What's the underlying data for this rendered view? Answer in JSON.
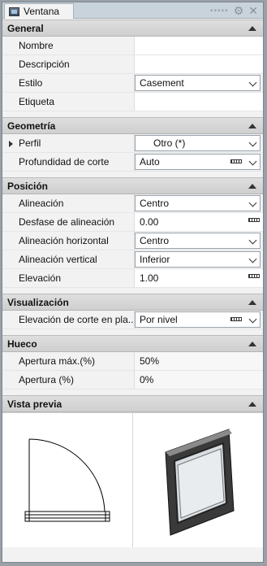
{
  "window": {
    "title": "Ventana"
  },
  "sections": {
    "general": {
      "title": "General",
      "nombre": {
        "label": "Nombre",
        "value": ""
      },
      "descripcion": {
        "label": "Descripción",
        "value": ""
      },
      "estilo": {
        "label": "Estilo",
        "value": "Casement"
      },
      "etiqueta": {
        "label": "Etiqueta",
        "value": ""
      }
    },
    "geometria": {
      "title": "Geometría",
      "perfil": {
        "label": "Perfil",
        "value": "Otro (*)"
      },
      "profundidad": {
        "label": "Profundidad de corte",
        "value": "Auto"
      }
    },
    "posicion": {
      "title": "Posición",
      "alineacion": {
        "label": "Alineación",
        "value": "Centro"
      },
      "desfase": {
        "label": "Desfase de alineación",
        "value": "0.00"
      },
      "alineacion_h": {
        "label": "Alineación horizontal",
        "value": "Centro"
      },
      "alineacion_v": {
        "label": "Alineación vertical",
        "value": "Inferior"
      },
      "elevacion": {
        "label": "Elevación",
        "value": "1.00"
      }
    },
    "visualizacion": {
      "title": "Visualización",
      "elevacion_corte": {
        "label": "Elevación de corte en pla...",
        "value": "Por nivel"
      }
    },
    "hueco": {
      "title": "Hueco",
      "apertura_max": {
        "label": "Apertura máx.(%)",
        "value": "50%"
      },
      "apertura": {
        "label": "Apertura (%)",
        "value": "0%"
      }
    },
    "vista_previa": {
      "title": "Vista previa"
    }
  }
}
